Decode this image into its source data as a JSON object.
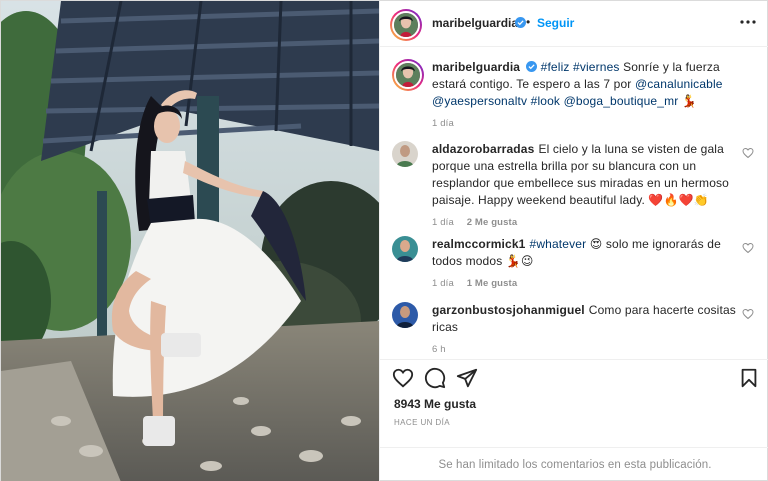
{
  "post": {
    "username": "maribelguardia",
    "follow_label": "Seguir",
    "dot": "•"
  },
  "caption": {
    "username": "maribelguardia",
    "parts": {
      "tags1": "#feliz #viernes",
      "text1": "Sonríe y la fuerza estará contigo. Te espero a las 7 por",
      "mention1": "@canalunicable",
      "mention2": "@yaespersonaltv",
      "tags2": "#look",
      "mention3": "@boga_boutique_mr",
      "emoji": "💃"
    },
    "time": "1 día"
  },
  "comments": [
    {
      "username": "aldazorobarradas",
      "text": "El cielo y la luna se visten de gala porque una estrella brilla por su blancura con un resplandor que embellece sus miradas en un hermoso paisaje. Happy weekend beautiful lady. ❤️🔥❤️👏",
      "time": "1 día",
      "likes": "2 Me gusta"
    },
    {
      "username": "realmccormick1",
      "tag": "#whatever",
      "text": "😍 solo me ignorarás de todos modos 💃😉",
      "time": "1 día",
      "likes": "1 Me gusta"
    },
    {
      "username": "garzonbustosjohanmiguel",
      "text": "Como para hacerte cositas ricas",
      "time": "6 h"
    }
  ],
  "actions": {
    "like_icon": "heart-icon",
    "comment_icon": "comment-icon",
    "share_icon": "share-icon",
    "save_icon": "bookmark-icon"
  },
  "stats": {
    "likes": "8943 Me gusta",
    "posted": "HACE UN DÍA"
  },
  "footer": {
    "limited": "Se han limitado los comentarios en esta publicación."
  },
  "colors": {
    "accent": "#0095f6",
    "link": "#00376b",
    "muted": "#8e8e8e",
    "text": "#262626"
  }
}
